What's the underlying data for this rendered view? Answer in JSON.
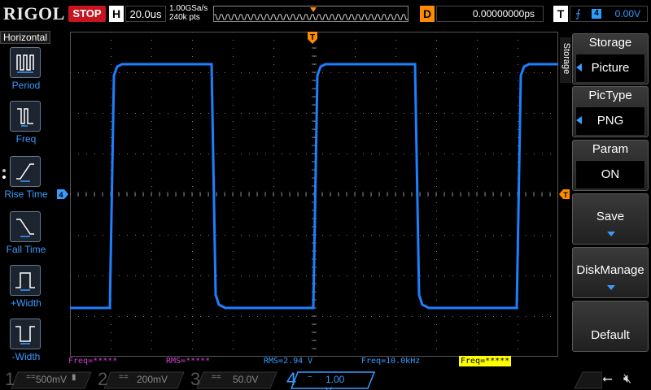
{
  "topbar": {
    "logo": "RIGOL",
    "run_state": "STOP",
    "horizontal_label": "H",
    "timebase": "20.0us",
    "sample_rate": "1.00GSa/s",
    "memory_depth": "240k pts",
    "delay_label": "D",
    "delay_value": "0.00000000ps",
    "trigger_label": "T",
    "trigger_edge_icon": "rising-edge-icon",
    "trigger_source": "4",
    "trigger_level": "0.00V"
  },
  "left_panel": {
    "title": "Horizontal",
    "items": [
      {
        "label": "Period",
        "icon": "period-icon"
      },
      {
        "label": "Freq",
        "icon": "freq-icon"
      },
      {
        "label": "Rise Time",
        "icon": "rise-time-icon"
      },
      {
        "label": "Fall Time",
        "icon": "fall-time-icon"
      },
      {
        "label": "+Width",
        "icon": "positive-width-icon"
      },
      {
        "label": "-Width",
        "icon": "negative-width-icon"
      }
    ]
  },
  "right_panel": {
    "tab": "Storage",
    "softkeys": [
      {
        "title": "Storage",
        "value": "Picture"
      },
      {
        "title": "PicType",
        "value": "PNG"
      },
      {
        "title": "Param",
        "value": "ON"
      },
      {
        "title": "Save"
      },
      {
        "title": "DiskManage"
      },
      {
        "title": "Default"
      }
    ]
  },
  "measurements": [
    {
      "text": "Freq=*****",
      "color": "#d040d0"
    },
    {
      "text": "RMS=*****",
      "color": "#d040d0"
    },
    {
      "text": "RMS=2.94 V",
      "color": "#3a9bff"
    },
    {
      "text": "Freq=10.0kHz",
      "color": "#3a9bff"
    },
    {
      "text": "Freq=*****",
      "color": "#000000",
      "bg": "#ffff00"
    }
  ],
  "channels": [
    {
      "num": "1",
      "coupling": "==",
      "scale": "500mV",
      "color": "#e8e830",
      "active": false
    },
    {
      "num": "2",
      "coupling": "==",
      "scale": "200mV",
      "color": "#30e8e8",
      "active": false
    },
    {
      "num": "3",
      "coupling": "==",
      "scale": "50.0V",
      "color": "#e040e0",
      "active": false
    },
    {
      "num": "4",
      "coupling": "~",
      "scale": "1.00 V",
      "color": "#3a9bff",
      "active": true
    }
  ],
  "colors": {
    "waveform": "#1e7fff",
    "trigger_marker": "#ff8c00",
    "grid_dot": "#7a7a7a"
  },
  "waveform": {
    "channel": "4",
    "shape": "square",
    "high_level_div": 3.2,
    "low_level_div": -2.8,
    "period_div": 5.0,
    "first_rise_div": 1.0,
    "duty": 0.5
  }
}
